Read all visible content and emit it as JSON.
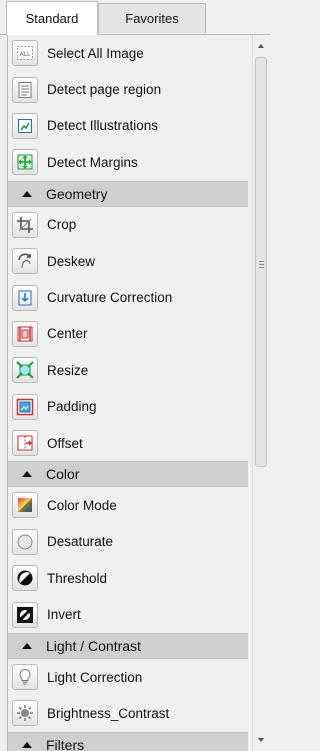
{
  "tabs": [
    "Standard",
    "Favorites"
  ],
  "groups": [
    {
      "section": null,
      "items": [
        {
          "label": "Select All Image",
          "icon": "select-all-icon"
        },
        {
          "label": "Detect page region",
          "icon": "page-region-icon"
        },
        {
          "label": "Detect Illustrations",
          "icon": "illustrations-icon"
        },
        {
          "label": "Detect Margins",
          "icon": "margins-icon"
        }
      ]
    },
    {
      "section": "Geometry",
      "items": [
        {
          "label": "Crop",
          "icon": "crop-icon"
        },
        {
          "label": "Deskew",
          "icon": "deskew-icon"
        },
        {
          "label": "Curvature Correction",
          "icon": "curvature-icon"
        },
        {
          "label": "Center",
          "icon": "center-icon"
        },
        {
          "label": "Resize",
          "icon": "resize-icon"
        },
        {
          "label": "Padding",
          "icon": "padding-icon"
        },
        {
          "label": "Offset",
          "icon": "offset-icon"
        }
      ]
    },
    {
      "section": "Color",
      "items": [
        {
          "label": "Color Mode",
          "icon": "color-mode-icon"
        },
        {
          "label": "Desaturate",
          "icon": "desaturate-icon"
        },
        {
          "label": "Threshold",
          "icon": "threshold-icon"
        },
        {
          "label": "Invert",
          "icon": "invert-icon"
        }
      ]
    },
    {
      "section": "Light / Contrast",
      "items": [
        {
          "label": "Light Correction",
          "icon": "light-correction-icon"
        },
        {
          "label": "Brightness_Contrast",
          "icon": "brightness-contrast-icon"
        }
      ]
    },
    {
      "section": "Filters",
      "items": []
    }
  ]
}
